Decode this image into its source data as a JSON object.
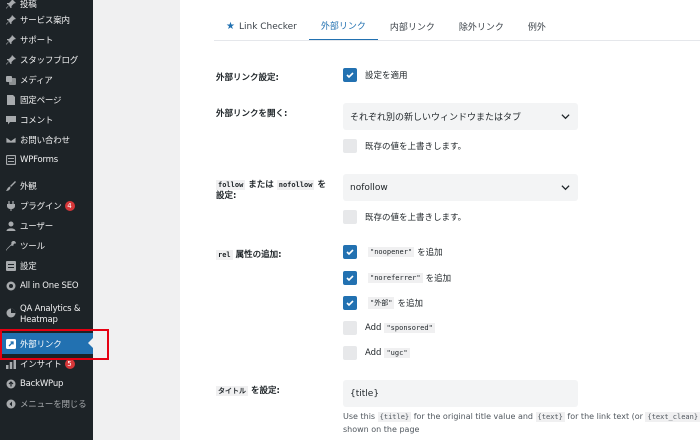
{
  "sidebar": {
    "items": [
      {
        "label": "投稿",
        "icon": "pin-icon"
      },
      {
        "label": "サービス案内",
        "icon": "pin-icon"
      },
      {
        "label": "サポート",
        "icon": "pin-icon"
      },
      {
        "label": "スタッフブログ",
        "icon": "pin-icon"
      },
      {
        "label": "メディア",
        "icon": "media-icon"
      },
      {
        "label": "固定ページ",
        "icon": "page-icon"
      },
      {
        "label": "コメント",
        "icon": "comment-icon"
      },
      {
        "label": "お問い合わせ",
        "icon": "mail-icon"
      },
      {
        "label": "WPForms",
        "icon": "forms-icon"
      },
      {
        "label": "外観",
        "icon": "brush-icon"
      },
      {
        "label": "プラグイン",
        "icon": "plugin-icon",
        "badge": "4"
      },
      {
        "label": "ユーザー",
        "icon": "user-icon"
      },
      {
        "label": "ツール",
        "icon": "wrench-icon"
      },
      {
        "label": "設定",
        "icon": "settings-icon"
      },
      {
        "label": "All in One SEO",
        "icon": "seo-icon"
      },
      {
        "label": "QA Analytics & Heatmap",
        "icon": "analytics-icon"
      },
      {
        "label": "外部リンク",
        "icon": "external-link-icon"
      },
      {
        "label": "インサイト",
        "icon": "insights-icon",
        "badge": "5"
      },
      {
        "label": "BackWPup",
        "icon": "backup-icon"
      },
      {
        "label": "メニューを閉じる",
        "icon": "collapse-icon"
      }
    ]
  },
  "tabs": [
    {
      "label": "Link Checker",
      "icon": "star-icon"
    },
    {
      "label": "外部リンク"
    },
    {
      "label": "内部リンク"
    },
    {
      "label": "除外リンク"
    },
    {
      "label": "例外"
    }
  ],
  "form": {
    "ext_settings_label": "外部リンク設定:",
    "apply_settings": "設定を適用",
    "open_ext_label": "外部リンクを開く:",
    "open_ext_value": "それぞれ別の新しいウィンドウまたはタブ",
    "overwrite_1": "既存の値を上書きします。",
    "follow_code": "follow",
    "follow_mid": "または",
    "nofollow_code": "nofollow",
    "follow_tail": "を",
    "follow_label2": "設定:",
    "follow_value": "nofollow",
    "overwrite_2": "既存の値を上書きします。",
    "rel_code": "rel",
    "rel_tail": "属性の追加:",
    "noopener_code": "\"noopener\"",
    "noopener_tail": "を追加",
    "noreferrer_code": "\"noreferrer\"",
    "noreferrer_tail": "を追加",
    "external_code": "\"外部\"",
    "external_tail": "を追加",
    "add_word_1": "Add",
    "sponsored_code": "\"sponsored\"",
    "add_word_2": "Add",
    "ugc_code": "\"ugc\"",
    "title_code": "タイトル",
    "title_tail": "を設定:",
    "title_value": "{title}",
    "help_use": "Use this",
    "help_title_code": "{title}",
    "help_mid": "for the original title value and",
    "help_text_code": "{text}",
    "help_for_link": "for the link text (or",
    "help_text_clean_code": "{text_clean}",
    "help_line2": "shown on the page"
  }
}
